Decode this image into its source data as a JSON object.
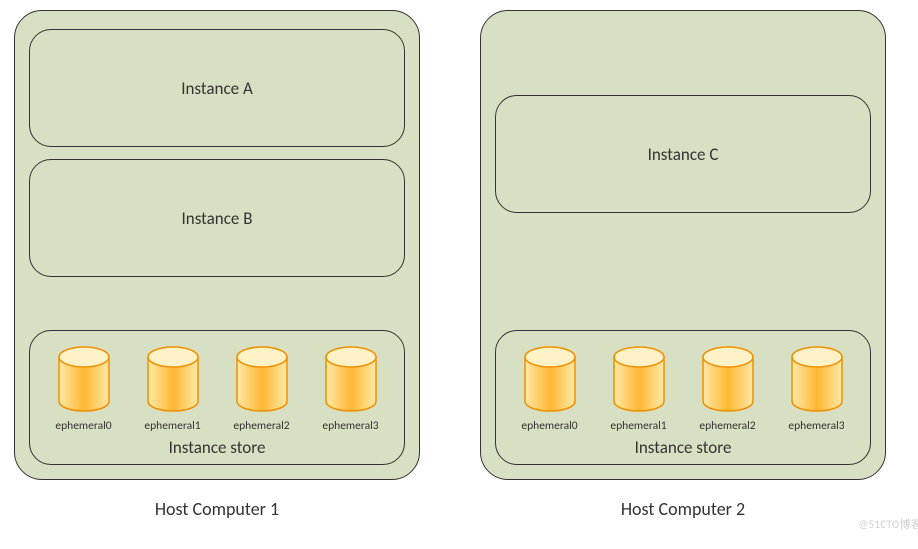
{
  "hosts": [
    {
      "label": "Host Computer 1",
      "instances": [
        "Instance A",
        "Instance B"
      ],
      "store_label": "Instance store",
      "disks": [
        "ephemeral0",
        "ephemeral1",
        "ephemeral2",
        "ephemeral3"
      ]
    },
    {
      "label": "Host Computer 2",
      "instances": [
        "Instance C"
      ],
      "store_label": "Instance store",
      "disks": [
        "ephemeral0",
        "ephemeral1",
        "ephemeral2",
        "ephemeral3"
      ]
    }
  ],
  "watermark": "@51CTO博客"
}
